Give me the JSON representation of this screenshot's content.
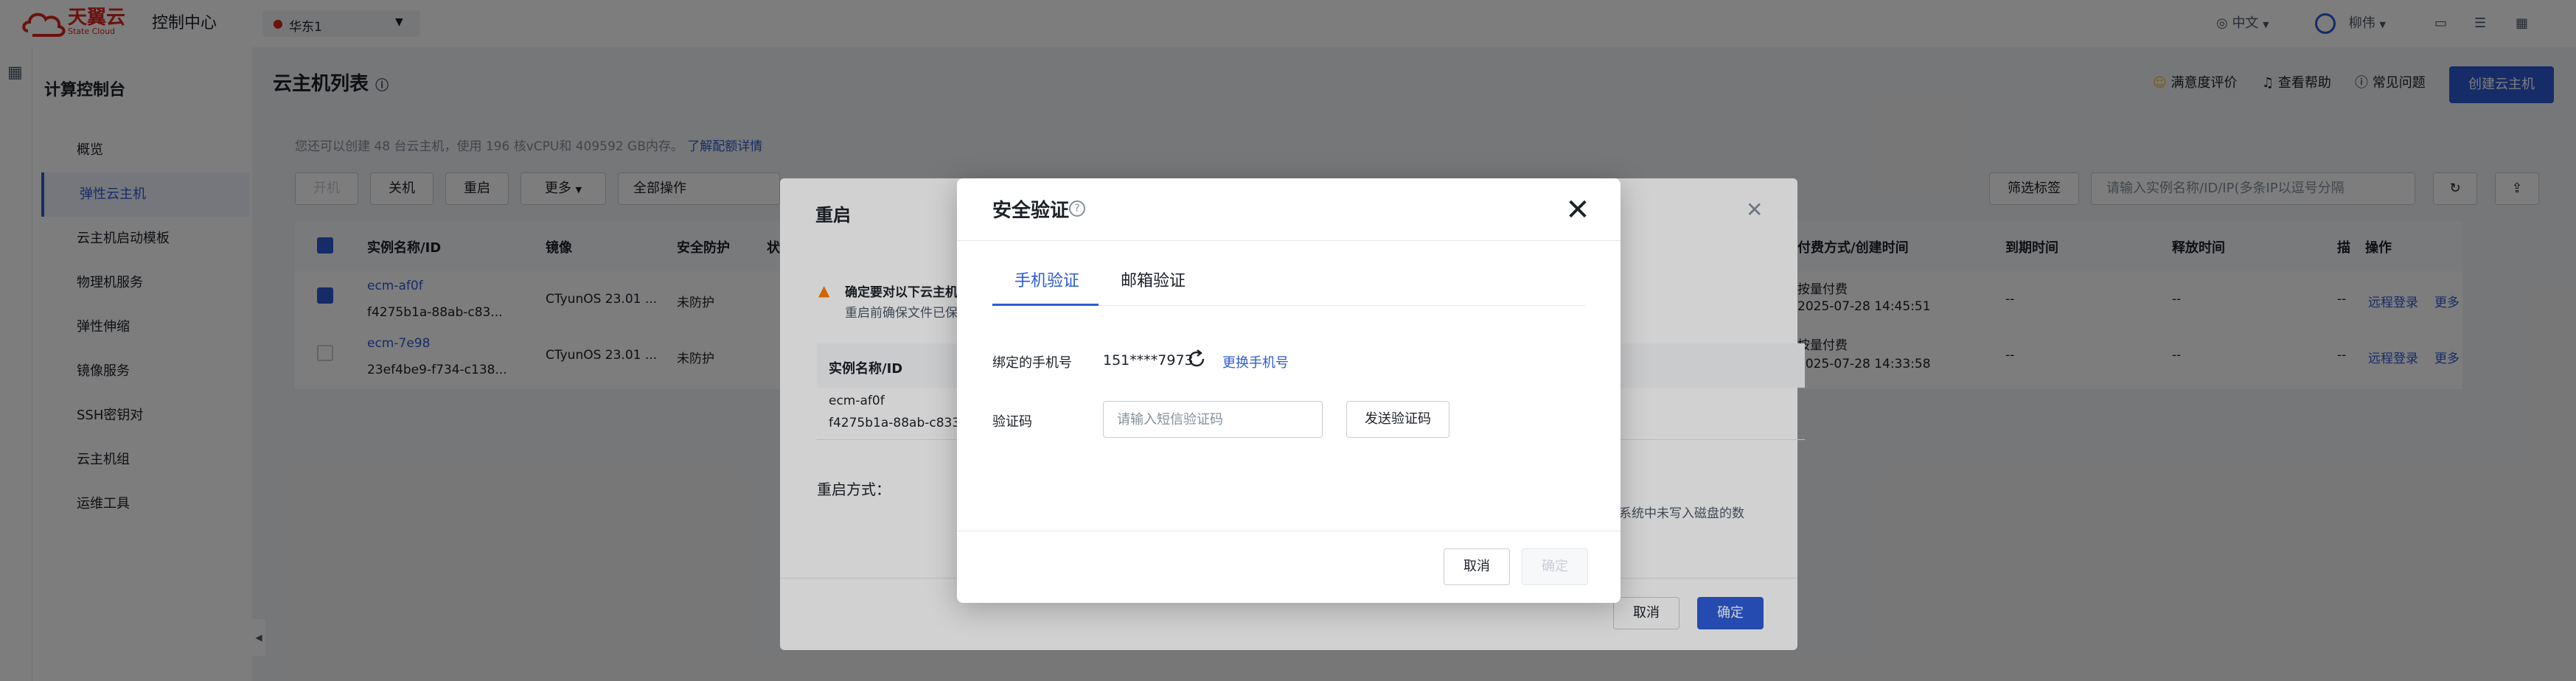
{
  "topbar": {
    "logo_text": "天翼云",
    "logo_sub": "State Cloud",
    "nav_title": "控制中心",
    "region": "华东1",
    "lang": "中文",
    "user": "柳伟"
  },
  "sidebar": {
    "title": "计算控制台",
    "items": [
      {
        "label": "概览"
      },
      {
        "label": "弹性云主机"
      },
      {
        "label": "云主机启动模板"
      },
      {
        "label": "物理机服务"
      },
      {
        "label": "弹性伸缩"
      },
      {
        "label": "镜像服务"
      },
      {
        "label": "SSH密钥对"
      },
      {
        "label": "云主机组"
      },
      {
        "label": "运维工具"
      }
    ]
  },
  "main": {
    "title": "云主机列表",
    "header_links": [
      "满意度评价",
      "查看帮助",
      "常见问题"
    ],
    "create_label": "创建云主机",
    "tip": "您还可以创建 48 台云主机，使用 196 核vCPU和 409592 GB内存。",
    "tip_link": "了解配额详情",
    "toolbar": {
      "start": "开机",
      "stop": "关机",
      "reboot": "重启",
      "more": "更多",
      "all_ops": "全部操作",
      "filter": "筛选标签",
      "search_placeholder": "请输入实例名称/ID/IP(多条IP以逗号分隔"
    },
    "table": {
      "headers": [
        "实例名称/ID",
        "镜像",
        "安全防护",
        "状",
        "付费方式/创建时间",
        "到期时间",
        "释放时间",
        "描",
        "操作"
      ],
      "rows": [
        {
          "name": "ecm-af0f",
          "id": "f4275b1a-88ab-c83...",
          "image": "CTyunOS 23.01 ...",
          "protect": "未防护",
          "pay": "按量付费",
          "created": "2025-07-28 14:45:51",
          "expire": "--",
          "release": "--",
          "desc": "--",
          "op1": "远程登录",
          "op2": "更多"
        },
        {
          "name": "ecm-7e98",
          "id": "23ef4be9-f734-c138...",
          "image": "CTyunOS 23.01 ...",
          "protect": "未防护",
          "pay": "按量付费",
          "created": "2025-07-28 14:33:58",
          "expire": "--",
          "release": "--",
          "desc": "--",
          "op1": "远程登录",
          "op2": "更多"
        }
      ]
    }
  },
  "reboot_dialog": {
    "title": "重启",
    "warn_title": "确定要对以下云主机",
    "warn_sub": "重启前确保文件已保",
    "col_header": "实例名称/ID",
    "row_name": "ecm-af0f",
    "row_id": "f4275b1a-88ab-c833...",
    "method_label": "重启方式：",
    "side_note": "系统中未写入磁盘的数",
    "cancel": "取消",
    "ok": "确定"
  },
  "security_dialog": {
    "title": "安全验证",
    "tabs": [
      "手机验证",
      "邮箱验证"
    ],
    "phone_label": "绑定的手机号",
    "phone_value": "151****7973",
    "change_phone": "更换手机号",
    "code_label": "验证码",
    "code_placeholder": "请输入短信验证码",
    "send_code": "发送验证码",
    "cancel": "取消",
    "ok": "确定"
  },
  "colors": {
    "accent": "#2e5bd7",
    "brand": "#d9261c"
  }
}
